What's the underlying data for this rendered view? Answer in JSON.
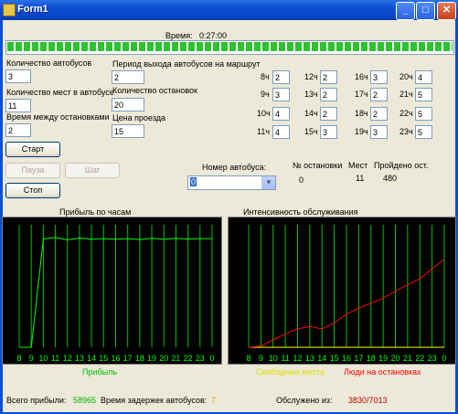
{
  "window": {
    "title": "Form1",
    "minimize": "_",
    "maximize": "□",
    "close": "✕"
  },
  "time": {
    "label": "Время:",
    "value": "0:27:00",
    "progress_fraction": 1.0
  },
  "params": {
    "buses_label": "Количество автобусов",
    "buses_value": "3",
    "seats_label": "Количество мест в автобусе",
    "seats_value": "11",
    "between_label": "Время между остановками",
    "between_value": "2",
    "period_label": "Период выхода автобусов на маршрут",
    "period_value": "2",
    "stops_label": "Количество остановок",
    "stops_value": "20",
    "price_label": "Цена проезда",
    "price_value": "15"
  },
  "hours": [
    {
      "label": "8ч",
      "value": "2"
    },
    {
      "label": "12ч",
      "value": "2"
    },
    {
      "label": "16ч",
      "value": "3"
    },
    {
      "label": "20ч",
      "value": "4"
    },
    {
      "label": "9ч",
      "value": "3"
    },
    {
      "label": "13ч",
      "value": "2"
    },
    {
      "label": "17ч",
      "value": "2"
    },
    {
      "label": "21ч",
      "value": "5"
    },
    {
      "label": "10ч",
      "value": "4"
    },
    {
      "label": "14ч",
      "value": "2"
    },
    {
      "label": "18ч",
      "value": "2"
    },
    {
      "label": "22ч",
      "value": "5"
    },
    {
      "label": "11ч",
      "value": "4"
    },
    {
      "label": "15ч",
      "value": "3"
    },
    {
      "label": "19ч",
      "value": "3"
    },
    {
      "label": "23ч",
      "value": "5"
    }
  ],
  "buttons": {
    "start": "Старт",
    "pause": "Пауза",
    "step": "Шаг",
    "stop": "Стоп"
  },
  "bus": {
    "label": "Номер автобуса:",
    "selected": "0"
  },
  "stats": {
    "stop_label": "№ остановки",
    "seats_label": "Мест",
    "passed_label": "Пройдено ост.",
    "stop_value": "0",
    "seats_value": "11",
    "passed_value": "480"
  },
  "footer": {
    "profit_label": "Всего прибыли:",
    "profit_value": "58965",
    "delay_label": "Время задержек автобусов:",
    "delay_value": "7",
    "served_label": "Обслужено из:",
    "served_value": "3830/7013"
  },
  "colors": {
    "green": "#00ff00",
    "yellow": "#ffff00",
    "red": "#ff0000",
    "grid": "#00c000"
  },
  "chart_data": [
    {
      "type": "line",
      "title": "Прибыль по часам",
      "categories": [
        "8",
        "9",
        "10",
        "11",
        "12",
        "13",
        "14",
        "15",
        "16",
        "17",
        "18",
        "19",
        "20",
        "21",
        "22",
        "23",
        "0"
      ],
      "series": [
        {
          "name": "Прибыль",
          "color": "#00ff00",
          "values": [
            0,
            0,
            3450,
            3500,
            3420,
            3480,
            3440,
            3460,
            3440,
            3460,
            3430,
            3470,
            3440,
            3470,
            3450,
            3460,
            3460
          ]
        }
      ],
      "ylim": [
        0,
        3900
      ]
    },
    {
      "type": "line",
      "title": "Интенсивность обслуживания",
      "categories": [
        "8",
        "9",
        "10",
        "11",
        "12",
        "13",
        "14",
        "15",
        "16",
        "17",
        "18",
        "19",
        "20",
        "21",
        "22",
        "23",
        "0"
      ],
      "series": [
        {
          "name": "Свободные места",
          "color": "#ffff00",
          "values": [
            0,
            0,
            0,
            0,
            0,
            0,
            0,
            0,
            0,
            0,
            0,
            0,
            0,
            0,
            0,
            0,
            0
          ]
        },
        {
          "name": "Люди на остановках",
          "color": "#ff0000",
          "values": [
            0,
            1,
            6,
            11,
            15,
            17,
            15,
            20,
            27,
            32,
            36,
            40,
            46,
            51,
            56,
            64,
            72
          ]
        }
      ],
      "ylim": [
        0,
        100
      ]
    }
  ]
}
